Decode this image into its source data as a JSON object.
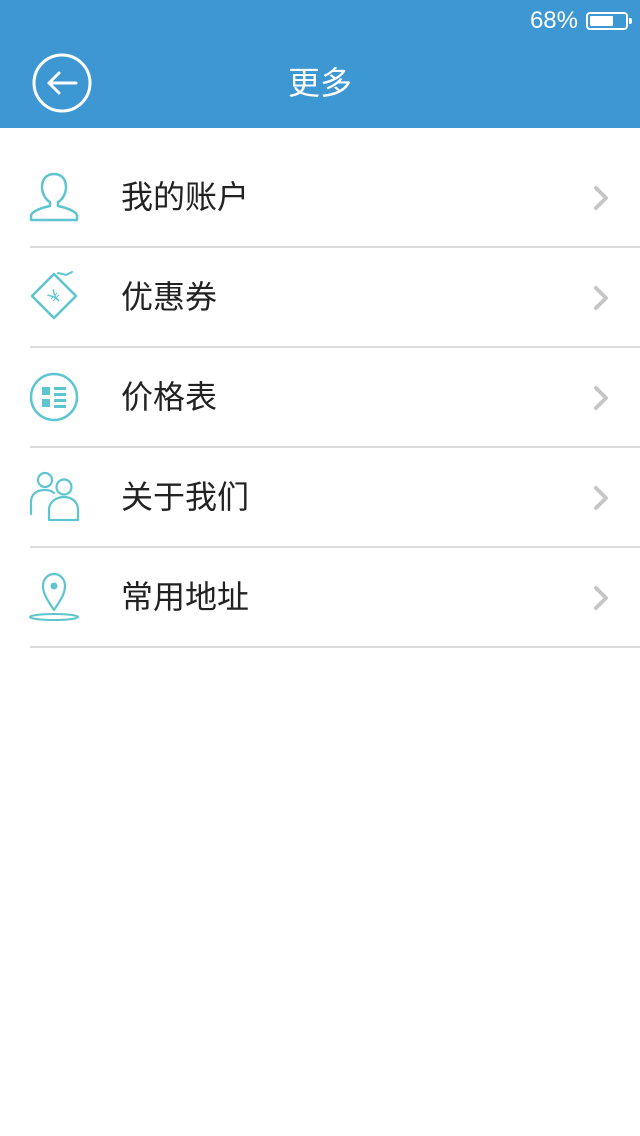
{
  "status_bar": {
    "battery_text": "68%",
    "battery_level": 0.68
  },
  "header": {
    "title": "更多"
  },
  "theme": {
    "header_bg": "#3d97d3",
    "icon_color": "#5cc5d0",
    "chevron_color": "#c6c6c6"
  },
  "menu": {
    "items": [
      {
        "label": "我的账户",
        "icon": "user-icon"
      },
      {
        "label": "优惠券",
        "icon": "coupon-icon"
      },
      {
        "label": "价格表",
        "icon": "price-list-icon"
      },
      {
        "label": "关于我们",
        "icon": "people-icon"
      },
      {
        "label": "常用地址",
        "icon": "location-pin-icon"
      }
    ]
  }
}
